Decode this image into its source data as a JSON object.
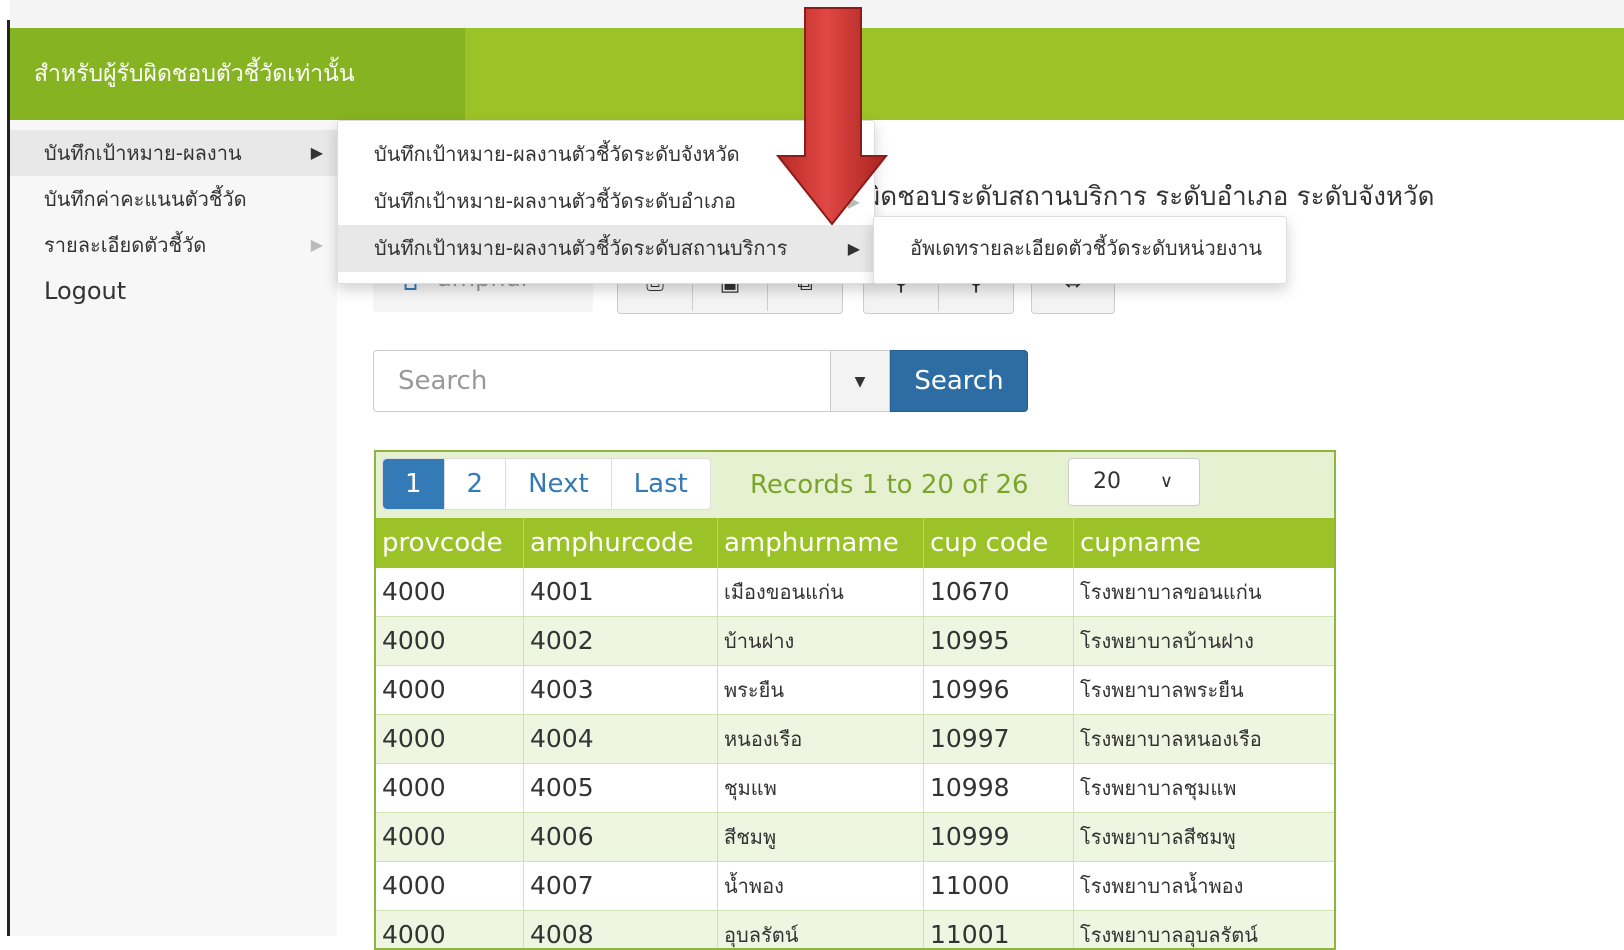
{
  "header": {
    "title": "สำหรับผู้รับผิดชอบตัวชี้วัดเท่านั้น"
  },
  "sidebar": {
    "items": [
      {
        "label": "บันทึกเป้าหมาย-ผลงาน"
      },
      {
        "label": "บันทึกค่าคะแนนตัวชี้วัด"
      },
      {
        "label": "รายละเอียดตัวชี้วัด"
      },
      {
        "label": "Logout"
      }
    ]
  },
  "submenu": {
    "items": [
      {
        "label": "บันทึกเป้าหมาย-ผลงานตัวชี้วัดระดับจังหวัด"
      },
      {
        "label": "บันทึกเป้าหมาย-ผลงานตัวชี้วัดระดับอำเภอ"
      },
      {
        "label": "บันทึกเป้าหมาย-ผลงานตัวชี้วัดระดับสถานบริการ"
      }
    ]
  },
  "submenu2": {
    "items": [
      {
        "label": "อัพเดทรายละเอียดตัวชี้วัดระดับหน่วยงาน"
      }
    ]
  },
  "page": {
    "heading": "ผิดชอบระดับสถานบริการ ระดับอำเภอ ระดับจังหวัด",
    "breadcrumb": "amphur"
  },
  "search": {
    "placeholder": "Search",
    "button_label": "Search"
  },
  "pager": {
    "pages": [
      "1",
      "2"
    ],
    "next_label": "Next",
    "last_label": "Last",
    "records_text": "Records 1 to 20 of 26",
    "page_size": "20"
  },
  "table": {
    "columns": [
      "provcode",
      "amphurcode",
      "amphurname",
      "cup code",
      "cupname"
    ],
    "rows": [
      [
        "4000",
        "4001",
        "เมืองขอนแก่น",
        "10670",
        "โรงพยาบาลขอนแก่น"
      ],
      [
        "4000",
        "4002",
        "บ้านฝาง",
        "10995",
        "โรงพยาบาลบ้านฝาง"
      ],
      [
        "4000",
        "4003",
        "พระยืน",
        "10996",
        "โรงพยาบาลพระยืน"
      ],
      [
        "4000",
        "4004",
        "หนองเรือ",
        "10997",
        "โรงพยาบาลหนองเรือ"
      ],
      [
        "4000",
        "4005",
        "ชุมแพ",
        "10998",
        "โรงพยาบาลชุมแพ"
      ],
      [
        "4000",
        "4006",
        "สีชมพู",
        "10999",
        "โรงพยาบาลสีชมพู"
      ],
      [
        "4000",
        "4007",
        "น้ำพอง",
        "11000",
        "โรงพยาบาลน้ำพอง"
      ],
      [
        "4000",
        "4008",
        "อุบลรัตน์",
        "11001",
        "โรงพยาบาลอุบลรัตน์"
      ]
    ]
  },
  "colors": {
    "header_green": "#9bc327",
    "header_dark_green": "#86b321",
    "primary_blue": "#337ab7",
    "arrow_red": "#d63a36"
  }
}
